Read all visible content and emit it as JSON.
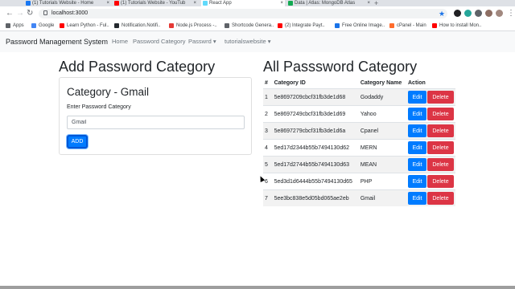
{
  "browser": {
    "tabs": [
      {
        "label": "(1) Tutorials Website - Home",
        "favicon_color": "#1877f2",
        "active": false
      },
      {
        "label": "(1) Tutorials Website - YouTub",
        "favicon_color": "#ff0000",
        "active": false
      },
      {
        "label": "React App",
        "favicon_color": "#61dafb",
        "active": true
      },
      {
        "label": "Data | Atlas: MongoDB Atlas",
        "favicon_color": "#13aa52",
        "active": false
      }
    ],
    "url": "localhost:3000",
    "bookmarks": [
      {
        "label": "Apps",
        "color": "#5f6368"
      },
      {
        "label": "Google",
        "color": "#4285f4"
      },
      {
        "label": "Learn Python - Ful..",
        "color": "#ff0000"
      },
      {
        "label": "Notification.Notifi..",
        "color": "#3c4043"
      },
      {
        "label": "Node.js Process -..",
        "color": "#e53935"
      },
      {
        "label": "Shortcode Genera..",
        "color": "#5f6368"
      },
      {
        "label": "(2) Integrate Payt..",
        "color": "#ff0000"
      },
      {
        "label": "Free Online Image..",
        "color": "#1a73e8"
      },
      {
        "label": "cPanel - Main",
        "color": "#ff6c2c"
      },
      {
        "label": "How to install Mon..",
        "color": "#ff0000"
      }
    ]
  },
  "navbar": {
    "brand": "Password Management System",
    "links": [
      "Home",
      "Password Category",
      "Passwrd ▾",
      "tutorialswebsite ▾"
    ]
  },
  "add_section": {
    "heading": "Add Password Category",
    "card_title": "Category - Gmail",
    "input_label": "Enter Password Category",
    "input_value": "Gmail",
    "button_label": "ADD"
  },
  "list_section": {
    "heading": "All Passsword Category",
    "columns": [
      "#",
      "Category ID",
      "Category Name",
      "Action"
    ],
    "edit_label": "Edit",
    "delete_label": "Delete",
    "rows": [
      {
        "num": "1",
        "id": "5e8697209cbcf31fb3de1d68",
        "name": "Godaddy"
      },
      {
        "num": "2",
        "id": "5e8697249cbcf31fb3de1d69",
        "name": "Yahoo"
      },
      {
        "num": "3",
        "id": "5e8697279cbcf31fb3de1d6a",
        "name": "Cpanel"
      },
      {
        "num": "4",
        "id": "5ed17d2344b55b7494130d62",
        "name": "MERN"
      },
      {
        "num": "5",
        "id": "5ed17d2744b55b7494130d63",
        "name": "MEAN"
      },
      {
        "num": "6",
        "id": "5ed3d1d6444b55b7494130d65",
        "name": "PHP"
      },
      {
        "num": "7",
        "id": "5ee3bc838e5d05bd065ae2eb",
        "name": "Gmail"
      }
    ]
  },
  "colors": {
    "primary": "#007bff",
    "danger": "#dc3545",
    "navbar_bg": "#f8f9fa"
  }
}
